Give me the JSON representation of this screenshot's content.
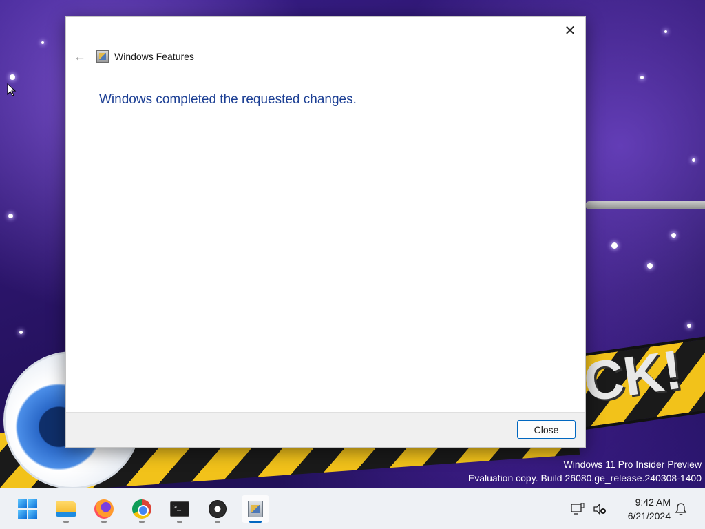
{
  "dialog": {
    "title": "Windows Features",
    "message": "Windows completed the requested changes.",
    "close_button_label": "Close",
    "close_glyph": "✕",
    "back_glyph": "←"
  },
  "watermark": {
    "line1": "Windows 11 Pro Insider Preview",
    "line2": "Evaluation copy. Build 26080.ge_release.240308-1400"
  },
  "wallpaper": {
    "text": "CK!"
  },
  "taskbar": {
    "items": [
      {
        "name": "start",
        "icon": "windows-start-icon",
        "active": false
      },
      {
        "name": "file-explorer",
        "icon": "folder-icon",
        "active": false
      },
      {
        "name": "firefox",
        "icon": "firefox-icon",
        "active": false
      },
      {
        "name": "chrome",
        "icon": "chrome-icon",
        "active": false
      },
      {
        "name": "terminal",
        "icon": "terminal-icon",
        "active": false
      },
      {
        "name": "obs",
        "icon": "obs-icon",
        "active": false
      },
      {
        "name": "windows-features",
        "icon": "windows-features-icon",
        "active": true
      }
    ],
    "terminal_glyph": ">_",
    "clock": {
      "time": "9:42 AM",
      "date": "6/21/2024"
    }
  },
  "colors": {
    "accent": "#0067c0",
    "message_text": "#1c3f94",
    "taskbar_bg": "#eef1f5"
  }
}
